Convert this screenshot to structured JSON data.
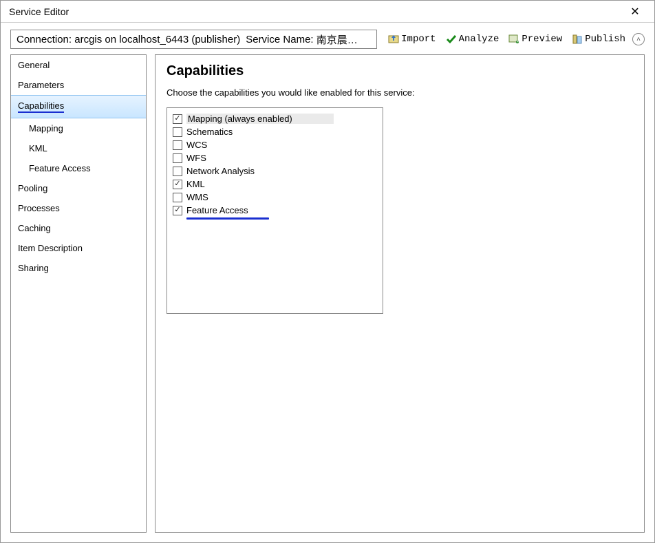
{
  "window": {
    "title": "Service Editor"
  },
  "toolbar": {
    "connection_label": "Connection:",
    "connection_value": "arcgis on localhost_6443 (publisher)",
    "service_name_label": "Service Name:",
    "service_name_value": "南京晨…",
    "buttons": {
      "import": "Import",
      "analyze": "Analyze",
      "preview": "Preview",
      "publish": "Publish"
    }
  },
  "sidebar": {
    "items": [
      {
        "label": "General",
        "sub": false,
        "selected": false
      },
      {
        "label": "Parameters",
        "sub": false,
        "selected": false
      },
      {
        "label": "Capabilities",
        "sub": false,
        "selected": true,
        "annotated": true
      },
      {
        "label": "Mapping",
        "sub": true,
        "selected": false
      },
      {
        "label": "KML",
        "sub": true,
        "selected": false
      },
      {
        "label": "Feature Access",
        "sub": true,
        "selected": false
      },
      {
        "label": "Pooling",
        "sub": false,
        "selected": false
      },
      {
        "label": "Processes",
        "sub": false,
        "selected": false
      },
      {
        "label": "Caching",
        "sub": false,
        "selected": false
      },
      {
        "label": "Item Description",
        "sub": false,
        "selected": false
      },
      {
        "label": "Sharing",
        "sub": false,
        "selected": false
      }
    ]
  },
  "main": {
    "title": "Capabilities",
    "description": "Choose the capabilities you would like enabled for this service:",
    "capabilities": [
      {
        "label": "Mapping (always enabled)",
        "checked": true,
        "highlight": true
      },
      {
        "label": "Schematics",
        "checked": false
      },
      {
        "label": "WCS",
        "checked": false
      },
      {
        "label": "WFS",
        "checked": false
      },
      {
        "label": "Network Analysis",
        "checked": false
      },
      {
        "label": "KML",
        "checked": true
      },
      {
        "label": "WMS",
        "checked": false
      },
      {
        "label": "Feature Access",
        "checked": true,
        "annotated": true
      }
    ]
  }
}
